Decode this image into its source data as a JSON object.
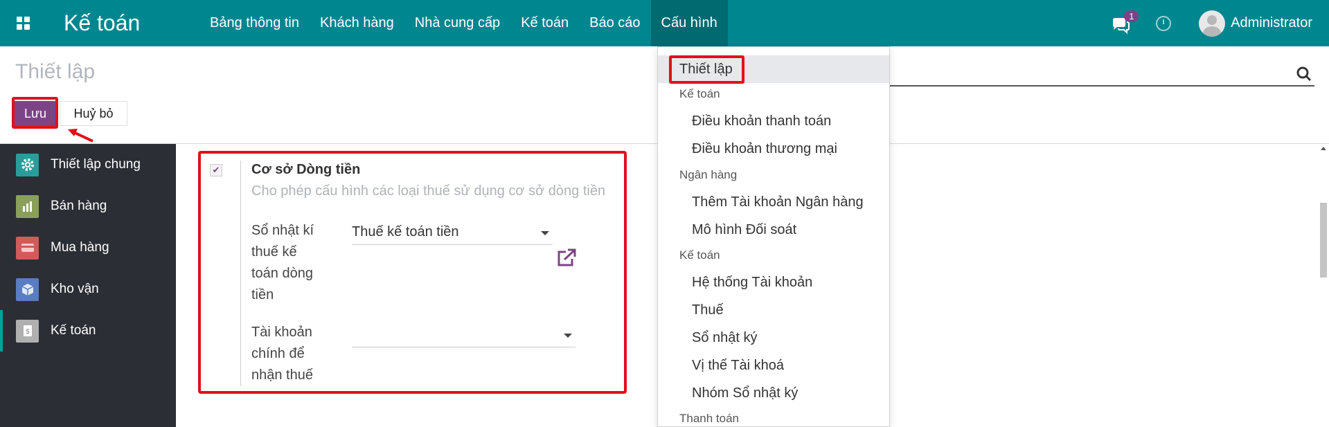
{
  "navbar": {
    "brand": "Kế toán",
    "menu": [
      "Bảng thông tin",
      "Khách hàng",
      "Nhà cung cấp",
      "Kế toán",
      "Báo cáo",
      "Cấu hình"
    ],
    "active_menu": "Cấu hình",
    "chat_badge": "1",
    "user_name": "Administrator"
  },
  "control_panel": {
    "title": "Thiết lập",
    "save_label": "Lưu",
    "cancel_label": "Huỷ bỏ"
  },
  "sidebar": {
    "items": [
      {
        "label": "Thiết lập chung",
        "icon": "gear-icon",
        "color": "#2a9d9a"
      },
      {
        "label": "Bán hàng",
        "icon": "sales-icon",
        "color": "#8aa05a"
      },
      {
        "label": "Mua hàng",
        "icon": "purchase-icon",
        "color": "#d15b5b"
      },
      {
        "label": "Kho vận",
        "icon": "inventory-icon",
        "color": "#5a7cc0"
      },
      {
        "label": "Kế toán",
        "icon": "accounting-icon",
        "color": "#b0b0b0"
      }
    ],
    "active": "Kế toán"
  },
  "setting": {
    "title": "Cơ sở Dòng tiền",
    "description": "Cho phép cấu hình các loại thuế sử dụng cơ sở dòng tiền",
    "journal_label": "Sổ nhật kí thuế kế toán dòng tiền",
    "journal_value": "Thuế kế toán tiền",
    "account_label": "Tài khoản chính để nhận thuế",
    "account_value": ""
  },
  "dropdown": {
    "highlight": "Thiết lập",
    "sections": [
      {
        "header": "Kế toán",
        "items": [
          "Điều khoản thanh toán",
          "Điều khoản thương mại"
        ]
      },
      {
        "header": "Ngân hàng",
        "items": [
          "Thêm Tài khoản Ngân hàng",
          "Mô hình Đối soát"
        ]
      },
      {
        "header": "Kế toán",
        "items": [
          "Hệ thống Tài khoản",
          "Thuế",
          "Sổ nhật ký",
          "Vị thế Tài khoá",
          "Nhóm Sổ nhật ký"
        ]
      },
      {
        "header": "Thanh toán",
        "items": []
      }
    ]
  }
}
